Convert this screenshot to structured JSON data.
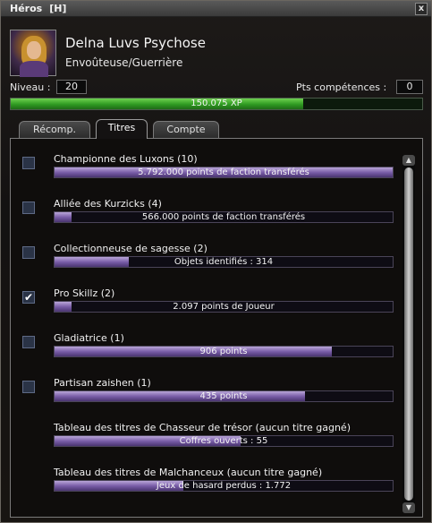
{
  "window": {
    "title": "Héros",
    "hotkey": "[H]",
    "close_label": "x"
  },
  "character": {
    "name": "Delna Luvs Psychose",
    "class": "Envoûteuse/Guerrière",
    "level_label": "Niveau :",
    "level": "20",
    "skill_points_label": "Pts compétences :",
    "skill_points": "0"
  },
  "xp": {
    "text": "150.075 XP",
    "fill_fraction": 0.71
  },
  "tabs": [
    {
      "label": "Récomp.",
      "active": false
    },
    {
      "label": "Titres",
      "active": true
    },
    {
      "label": "Compte",
      "active": false
    }
  ],
  "titles": [
    {
      "name": "Championne des Luxons (10)",
      "progress_text": "5.792.000 points de faction transférés",
      "fill": 1.0,
      "checked": false,
      "has_checkbox": true
    },
    {
      "name": "Alliée des Kurzicks (4)",
      "progress_text": "566.000 points de faction transférés",
      "fill": 0.05,
      "checked": false,
      "has_checkbox": true
    },
    {
      "name": "Collectionneuse de sagesse (2)",
      "progress_text": "Objets identifiés : 314",
      "fill": 0.22,
      "checked": false,
      "has_checkbox": true
    },
    {
      "name": "Pro Skillz (2)",
      "progress_text": "2.097 points de Joueur",
      "fill": 0.05,
      "checked": true,
      "has_checkbox": true
    },
    {
      "name": "Gladiatrice (1)",
      "progress_text": "906 points",
      "fill": 0.82,
      "checked": false,
      "has_checkbox": true
    },
    {
      "name": "Partisan zaishen (1)",
      "progress_text": "435 points",
      "fill": 0.74,
      "checked": false,
      "has_checkbox": true
    },
    {
      "name": "Tableau des titres de Chasseur de trésor (aucun titre gagné)",
      "progress_text": "Coffres ouverts : 55",
      "fill": 0.55,
      "checked": false,
      "has_checkbox": false
    },
    {
      "name": "Tableau des titres de Malchanceux (aucun titre gagné)",
      "progress_text": "Jeux de hasard perdus : 1.772",
      "fill": 0.38,
      "checked": false,
      "has_checkbox": false
    }
  ],
  "colors": {
    "xp_fill": "#3cab2a",
    "title_fill": "#7a5ea8",
    "checkbox": "#2a3346"
  }
}
